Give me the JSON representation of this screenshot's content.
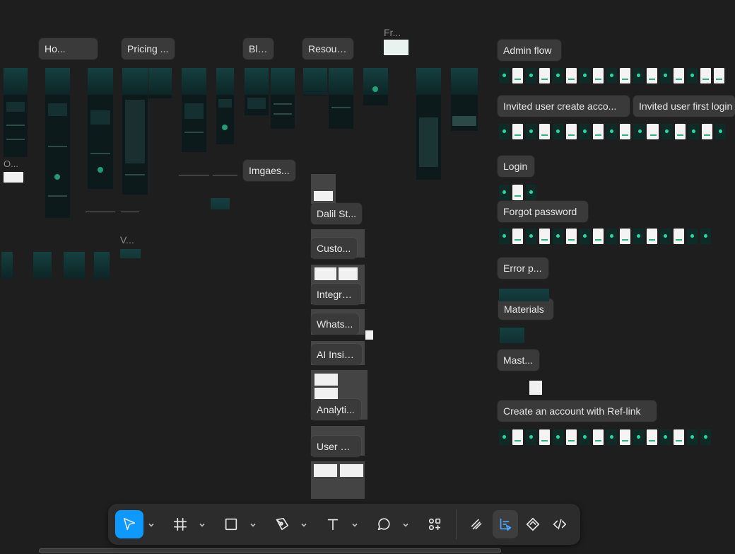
{
  "canvas": {
    "page_labels": {
      "home": "Ho...",
      "pricing": "Pricing ...",
      "blog": "Blog",
      "resources": "Resour...",
      "images": "Imgaes...",
      "fr": "Fr...",
      "o": "O...",
      "v": "V..."
    },
    "product_labels": {
      "dalil": "Dalil St...",
      "custo": "Custo...",
      "integra": "Integra...",
      "whats": "Whats...",
      "ai": "AI Insig...",
      "analytics": "Analyti...",
      "user": "User M..."
    },
    "flow_labels": {
      "admin_flow": "Admin flow",
      "invited_create": "Invited user create acco...",
      "invited_first_login": "Invited user first login",
      "login": "Login",
      "forgot_password": "Forgot password",
      "error": "Error p...",
      "materials": "Materials",
      "mast": "Mast...",
      "create_ref": "Create an account with Ref-link"
    }
  },
  "toolbar": {
    "tools": [
      {
        "name": "move-tool",
        "icon": "cursor-icon",
        "active": true
      },
      {
        "name": "frame-tool",
        "icon": "hash-frame-icon"
      },
      {
        "name": "shape-tool",
        "icon": "rectangle-icon"
      },
      {
        "name": "pen-tool",
        "icon": "pen-icon"
      },
      {
        "name": "text-tool",
        "icon": "text-icon"
      },
      {
        "name": "comment-tool",
        "icon": "comment-icon"
      },
      {
        "name": "actions-tool",
        "icon": "shapes-plus-icon"
      },
      {
        "name": "draw-mode",
        "icon": "pencil-draw-icon"
      },
      {
        "name": "design-mode",
        "icon": "design-mode-icon",
        "active": true
      },
      {
        "name": "prototype-mode",
        "icon": "diamond-icon"
      },
      {
        "name": "dev-mode",
        "icon": "code-icon"
      }
    ],
    "accent": "#0d99ff",
    "background": "#2c2c2c"
  }
}
